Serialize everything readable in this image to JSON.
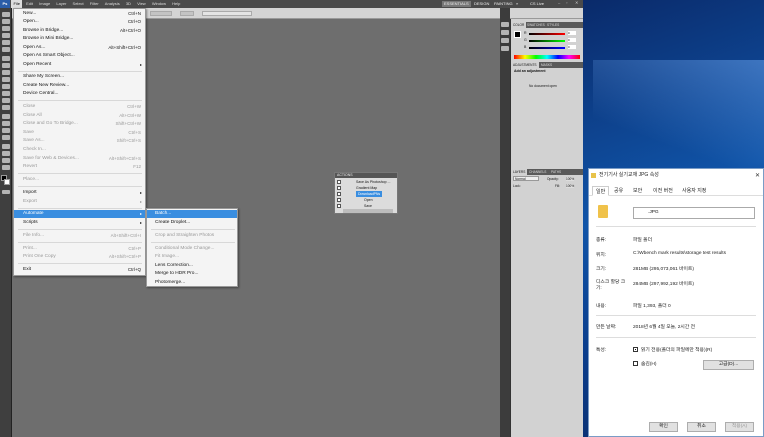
{
  "menubar": {
    "items": [
      "Ps",
      "File",
      "Edit",
      "Image",
      "Layer",
      "Select",
      "Filter",
      "Analysis",
      "3D",
      "View",
      "Window",
      "Help"
    ],
    "workspaces": [
      "ESSENTIALS",
      "DESIGN",
      "PAINTING",
      "»",
      "CS Live"
    ]
  },
  "file_menu": {
    "items": [
      {
        "label": "New...",
        "shortcut": "Ctrl+N",
        "disabled": false
      },
      {
        "label": "Open...",
        "shortcut": "Ctrl+O",
        "disabled": false
      },
      {
        "label": "Browse in Bridge...",
        "shortcut": "Alt+Ctrl+O",
        "disabled": false
      },
      {
        "label": "Browse in Mini Bridge...",
        "shortcut": "",
        "disabled": false
      },
      {
        "label": "Open As...",
        "shortcut": "Alt+Shift+Ctrl+O",
        "disabled": false
      },
      {
        "label": "Open As Smart Object...",
        "shortcut": "",
        "disabled": false
      },
      {
        "label": "Open Recent",
        "shortcut": "",
        "disabled": false,
        "submenu": true
      },
      {
        "label": "Share My Screen...",
        "shortcut": "",
        "disabled": false
      },
      {
        "label": "Create New Review...",
        "shortcut": "",
        "disabled": false
      },
      {
        "label": "Device Central...",
        "shortcut": "",
        "disabled": false
      },
      {
        "label": "Close",
        "shortcut": "Ctrl+W",
        "disabled": true
      },
      {
        "label": "Close All",
        "shortcut": "Alt+Ctrl+W",
        "disabled": true
      },
      {
        "label": "Close and Go To Bridge...",
        "shortcut": "Shift+Ctrl+W",
        "disabled": true
      },
      {
        "label": "Save",
        "shortcut": "Ctrl+S",
        "disabled": true
      },
      {
        "label": "Save As...",
        "shortcut": "Shift+Ctrl+S",
        "disabled": true
      },
      {
        "label": "Check In...",
        "shortcut": "",
        "disabled": true
      },
      {
        "label": "Save for Web & Devices...",
        "shortcut": "Alt+Shift+Ctrl+S",
        "disabled": true
      },
      {
        "label": "Revert",
        "shortcut": "F12",
        "disabled": true
      },
      {
        "label": "Place...",
        "shortcut": "",
        "disabled": true
      },
      {
        "label": "Import",
        "shortcut": "",
        "disabled": false,
        "submenu": true
      },
      {
        "label": "Export",
        "shortcut": "",
        "disabled": true,
        "submenu": true
      },
      {
        "label": "Automate",
        "shortcut": "",
        "disabled": false,
        "submenu": true,
        "highlighted": true
      },
      {
        "label": "Scripts",
        "shortcut": "",
        "disabled": false,
        "submenu": true
      },
      {
        "label": "File Info...",
        "shortcut": "Alt+Shift+Ctrl+I",
        "disabled": true
      },
      {
        "label": "Print...",
        "shortcut": "Ctrl+P",
        "disabled": true
      },
      {
        "label": "Print One Copy",
        "shortcut": "Alt+Shift+Ctrl+P",
        "disabled": true
      },
      {
        "label": "Exit",
        "shortcut": "Ctrl+Q",
        "disabled": false
      }
    ]
  },
  "automate_menu": {
    "items": [
      {
        "label": "Batch...",
        "disabled": false,
        "highlighted": true
      },
      {
        "label": "Create Droplet...",
        "disabled": false
      },
      {
        "label": "Crop and Straighten Photos",
        "disabled": true
      },
      {
        "label": "Conditional Mode Change...",
        "disabled": true
      },
      {
        "label": "Fit Image...",
        "disabled": true
      },
      {
        "label": "Lens Correction...",
        "disabled": false
      },
      {
        "label": "Merge to HDR Pro...",
        "disabled": false
      },
      {
        "label": "Photomerge...",
        "disabled": false
      }
    ]
  },
  "actions_panel": {
    "title": "ACTIONS",
    "rows": [
      "Save As Photoshop ...",
      "Gradient Map",
      "DownloadPNs",
      "Open",
      "Save"
    ]
  },
  "right_panels": {
    "tabs_top": [
      "COLOR",
      "SWATCHES",
      "STYLES"
    ],
    "tabs_mid": [
      "ADJUSTMENTS",
      "MASKS"
    ],
    "add_adjustment": "Add an adjustment",
    "no_doc": "No document open",
    "tabs_layers": [
      "LAYERS",
      "CHANNELS",
      "PATHS"
    ],
    "blend_mode": "Normal",
    "opacity_label": "Opacity:",
    "opacity_value": "100%",
    "fill_label": "Fill:",
    "fill_value": "100%",
    "lock_label": "Lock:",
    "color_labels": [
      "R",
      "G",
      "B"
    ],
    "color_values": [
      "0",
      "0",
      "0"
    ]
  },
  "properties": {
    "title": "전기기사 실기교재 JPG 속성",
    "tabs": [
      "일반",
      "공유",
      "보안",
      "이전 버전",
      "사용자 지정"
    ],
    "name_suffix": ".JPG",
    "rows": [
      {
        "label": "종류:",
        "value": "파일 폴더"
      },
      {
        "label": "위치:",
        "value": "C:\\Wbench mark results\\storage test results"
      },
      {
        "label": "크기:",
        "value": "281MB (295,073,061 바이트)"
      },
      {
        "label": "디스크 할당 크기:",
        "value": "284MB (297,992,192 바이트)"
      },
      {
        "label": "내용:",
        "value": "파일 1,393, 폴더 0"
      },
      {
        "label": "만든 날짜:",
        "value": "2018년 6월 4일 오늘, 2시간 전"
      },
      {
        "label": "특성:",
        "value": ""
      }
    ],
    "readonly_label": "읽기 전용(폴더의 파일에만 적용)(R)",
    "hidden_label": "숨김(H)",
    "advanced_button": "고급(D)...",
    "ok_button": "확인",
    "cancel_button": "취소",
    "apply_button": "적용(A)"
  }
}
